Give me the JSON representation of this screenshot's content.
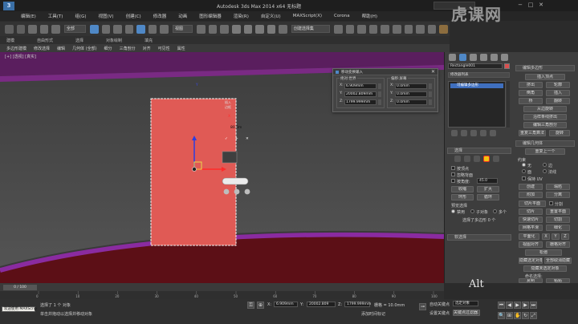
{
  "title_bar": {
    "logo_text": "3",
    "title": "Autodesk 3ds Max  2014 x64     无标题",
    "window_controls": [
      "−",
      "□",
      "✕"
    ]
  },
  "menu": [
    "编辑(E)",
    "工具(T)",
    "组(G)",
    "视图(V)",
    "创建(C)",
    "修改器",
    "动画",
    "图形编辑器",
    "渲染(R)",
    "自定义(U)",
    "MAXScript(X)",
    "Corona",
    "帮助(H)"
  ],
  "toolbar": {
    "selection_filter": "全部",
    "view_dropdown": "视图",
    "named_selection": "创建选择集"
  },
  "ribbon": {
    "tabs": [
      "建模",
      "自由形式",
      "选择",
      "对象绘制",
      "填充"
    ],
    "tools": [
      "多边形建模",
      "修改选择",
      "编辑",
      "几何体 (全部)",
      "细分",
      "三角剖分",
      "对齐",
      "可见性",
      "属性"
    ]
  },
  "viewport": {
    "label": "[+] [透视] [真实]"
  },
  "gizmo": {
    "label_x": "X",
    "label_y": "Y",
    "tooltip_lines": [
      "插入",
      "边框"
    ],
    "value": "80.0m",
    "confirm_icons": [
      "✓",
      "+",
      "✕"
    ]
  },
  "dialog": {
    "title": "移动变换输入",
    "close": "✕",
    "absolute_title": "绝对:世界",
    "offset_title": "偏移:屏幕",
    "absolute": [
      {
        "axis": "X:",
        "value": "6.909mm"
      },
      {
        "axis": "Y:",
        "value": "20002.809mm"
      },
      {
        "axis": "Z:",
        "value": "1799.999mm"
      }
    ],
    "offset": [
      {
        "axis": "X:",
        "value": "0.0mm"
      },
      {
        "axis": "Y:",
        "value": "0.0mm"
      },
      {
        "axis": "Z:",
        "value": "0.0mm"
      }
    ]
  },
  "command_panel": {
    "object_name": "Rectangle001",
    "color_swatch": "#d94f4f",
    "modifier_list": "修改器列表",
    "stack_item": "可编辑多边形",
    "selection_title": "选择",
    "options": {
      "by_vertex": "按顶点",
      "ignore_backfacing": "忽略背面",
      "by_angle": "按角度:",
      "angle_value": "45.0"
    },
    "buttons": {
      "shrink": "收缩",
      "grow": "扩大",
      "ring": "环形",
      "loop": "循环"
    },
    "preview_selection": "预览选择",
    "preview_modes": [
      "禁用",
      "子对象",
      "多个"
    ],
    "selection_status": "选择了多边形 0 个",
    "soft_selection": "软选择",
    "edit_polygons_title": "编辑多边形",
    "insert_vertex": "插入顶点",
    "edit_polygons_buttons": [
      [
        "挤出",
        "轮廓"
      ],
      [
        "倒角",
        "插入"
      ],
      [
        "桥",
        "翻转"
      ]
    ],
    "hinge": "从边旋转",
    "extrude_along_spline": "沿样条线挤出",
    "edit_triangulation": "编辑三角剖分",
    "retriangulate": "重复三角算法",
    "turn": "旋转",
    "edit_geometry_title": "编辑几何体",
    "repeat_last": "重复上一个",
    "constraints_label": "约束",
    "constraints": [
      "无",
      "边",
      "面",
      "法线"
    ],
    "preserve_uvs": "保持 UV",
    "create": "创建",
    "collapse": "塌陷",
    "attach": "附加",
    "detach": "分离",
    "slice_plane": "切片平面",
    "split": "分割",
    "slice": "切片",
    "reset_plane": "重置平面",
    "quickslice": "快速切片",
    "cut": "切割",
    "meshsmooth": "网格平滑",
    "tessellate": "细化",
    "make_planar": "平面化",
    "xyz": [
      "X",
      "Y",
      "Z"
    ],
    "view_align": "视图对齐",
    "grid_align": "栅格对齐",
    "relax": "松弛",
    "hide_selected": "隐藏选定对象",
    "unhide_all": "全部取消隐藏",
    "hide_unselected": "隐藏未选定对象",
    "named_selections": "命名选择:",
    "copy": "复制",
    "paste": "粘贴",
    "delete_isolated": "删除孤立顶点"
  },
  "timeline": {
    "frame": "0 / 100"
  },
  "trackbar_ticks": [
    "0",
    "10",
    "20",
    "30",
    "40",
    "50",
    "60",
    "70",
    "80",
    "90",
    "100"
  ],
  "status_bar": {
    "welcome": "欢迎使用 MAXScrip",
    "selected": "选择了 1 个 对象",
    "prompt": "单击并拖动以选择并移动对象",
    "x_label": "X:",
    "x_value": "6.909mm",
    "y_label": "Y:",
    "y_value": "20002.809",
    "z_label": "Z:",
    "z_value": "1799.999mm",
    "grid": "栅格 = 10.0mm",
    "auto_key": "自动关键点",
    "selected_object": "选定对象",
    "set_key": "设置关键点",
    "key_filters": "关键点过滤器...",
    "add_time_tag": "添加时间标记"
  },
  "watermark": "虎课网",
  "alt_key": "Alt"
}
